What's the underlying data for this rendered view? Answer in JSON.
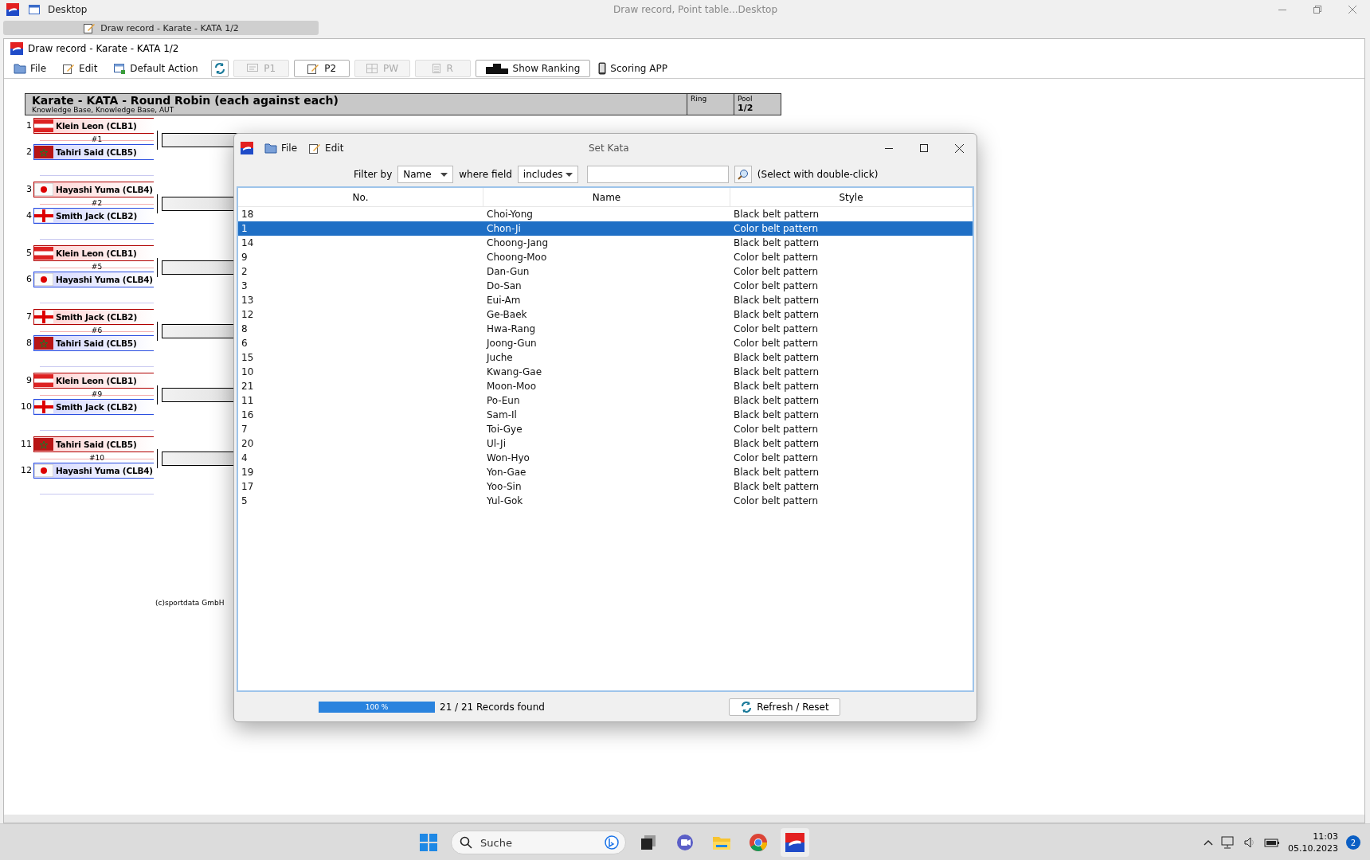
{
  "os_titlebar": {
    "title": "Desktop",
    "center_title": "Draw record, Point table...Desktop"
  },
  "document_tab": {
    "label": "Draw record - Karate - KATA 1/2"
  },
  "window": {
    "title": "Draw record - Karate - KATA 1/2",
    "toolbar": [
      {
        "kind": "menu",
        "label": "File",
        "disabled": false
      },
      {
        "kind": "menu",
        "label": "Edit",
        "disabled": false
      },
      {
        "kind": "menu",
        "label": "Default Action",
        "disabled": false
      },
      {
        "kind": "iconbutton",
        "disabled": false
      },
      {
        "kind": "button",
        "label": "P1",
        "disabled": true
      },
      {
        "kind": "button",
        "label": "P2",
        "disabled": false
      },
      {
        "kind": "button",
        "label": "PW",
        "disabled": true
      },
      {
        "kind": "button",
        "label": "R",
        "disabled": true
      },
      {
        "kind": "button",
        "label": "Show Ranking",
        "disabled": false
      },
      {
        "kind": "menu",
        "label": "Scoring APP",
        "disabled": false
      }
    ]
  },
  "draw": {
    "header": {
      "title": "Karate - KATA - Round Robin (each against each)",
      "subtitle": "Knowledge Base, Knowledge Base, AUT",
      "ring_label": "Ring",
      "pool_label": "Pool",
      "pool_value": "1/2"
    },
    "matches": [
      {
        "number": "#1",
        "competitors": [
          {
            "seed": "1",
            "name": "Klein Leon (CLB1)",
            "kind": "aut"
          },
          {
            "seed": "2",
            "name": "Tahiri Said (CLB5)",
            "kind": "mar"
          }
        ]
      },
      {
        "number": "#2",
        "competitors": [
          {
            "seed": "3",
            "name": "Hayashi Yuma (CLB4)",
            "kind": "jpn"
          },
          {
            "seed": "4",
            "name": "Smith Jack (CLB2)",
            "kind": "eng"
          }
        ]
      },
      {
        "number": "#5",
        "competitors": [
          {
            "seed": "5",
            "name": "Klein Leon (CLB1)",
            "kind": "aut"
          },
          {
            "seed": "6",
            "name": "Hayashi Yuma (CLB4)",
            "kind": "jpn"
          }
        ]
      },
      {
        "number": "#6",
        "competitors": [
          {
            "seed": "7",
            "name": "Smith Jack (CLB2)",
            "kind": "eng"
          },
          {
            "seed": "8",
            "name": "Tahiri Said (CLB5)",
            "kind": "mar"
          }
        ]
      },
      {
        "number": "#9",
        "competitors": [
          {
            "seed": "9",
            "name": "Klein Leon (CLB1)",
            "kind": "aut"
          },
          {
            "seed": "10",
            "name": "Smith Jack (CLB2)",
            "kind": "eng"
          }
        ]
      },
      {
        "number": "#10",
        "competitors": [
          {
            "seed": "11",
            "name": "Tahiri Said (CLB5)",
            "kind": "mar"
          },
          {
            "seed": "12",
            "name": "Hayashi Yuma (CLB4)",
            "kind": "jpn"
          }
        ]
      }
    ],
    "copyright": "(c)sportdata GmbH"
  },
  "dialog": {
    "title": "Set Kata",
    "menu": [
      "File",
      "Edit"
    ],
    "filter": {
      "label": "Filter by",
      "field": "Name",
      "where_label": "where field",
      "operator": "includes",
      "hint": "(Select with double-click)"
    },
    "columns": [
      "No.",
      "Name",
      "Style"
    ],
    "rows": [
      {
        "no": "18",
        "name": "Choi-Yong",
        "style": "Black belt pattern",
        "selected": false
      },
      {
        "no": "1",
        "name": "Chon-Ji",
        "style": "Color belt pattern",
        "selected": true
      },
      {
        "no": "14",
        "name": "Choong-Jang",
        "style": "Black belt pattern",
        "selected": false
      },
      {
        "no": "9",
        "name": "Choong-Moo",
        "style": "Color belt pattern",
        "selected": false
      },
      {
        "no": "2",
        "name": "Dan-Gun",
        "style": "Color belt pattern",
        "selected": false
      },
      {
        "no": "3",
        "name": "Do-San",
        "style": "Color belt pattern",
        "selected": false
      },
      {
        "no": "13",
        "name": "Eui-Am",
        "style": "Black belt pattern",
        "selected": false
      },
      {
        "no": "12",
        "name": "Ge-Baek",
        "style": "Black belt pattern",
        "selected": false
      },
      {
        "no": "8",
        "name": "Hwa-Rang",
        "style": "Color belt pattern",
        "selected": false
      },
      {
        "no": "6",
        "name": "Joong-Gun",
        "style": "Color belt pattern",
        "selected": false
      },
      {
        "no": "15",
        "name": "Juche",
        "style": "Black belt pattern",
        "selected": false
      },
      {
        "no": "10",
        "name": "Kwang-Gae",
        "style": "Black belt pattern",
        "selected": false
      },
      {
        "no": "21",
        "name": "Moon-Moo",
        "style": "Black belt pattern",
        "selected": false
      },
      {
        "no": "11",
        "name": "Po-Eun",
        "style": "Black belt pattern",
        "selected": false
      },
      {
        "no": "16",
        "name": "Sam-Il",
        "style": "Black belt pattern",
        "selected": false
      },
      {
        "no": "7",
        "name": "Toi-Gye",
        "style": "Color belt pattern",
        "selected": false
      },
      {
        "no": "20",
        "name": "Ul-Ji",
        "style": "Black belt pattern",
        "selected": false
      },
      {
        "no": "4",
        "name": "Won-Hyo",
        "style": "Color belt pattern",
        "selected": false
      },
      {
        "no": "19",
        "name": "Yon-Gae",
        "style": "Black belt pattern",
        "selected": false
      },
      {
        "no": "17",
        "name": "Yoo-Sin",
        "style": "Black belt pattern",
        "selected": false
      },
      {
        "no": "5",
        "name": "Yul-Gok",
        "style": "Color belt pattern",
        "selected": false
      }
    ],
    "progress": {
      "level": 1,
      "text": "100 %"
    },
    "records": "21 / 21 Records found",
    "refresh_button": "Refresh / Reset"
  },
  "taskbar": {
    "search_placeholder": "Suche",
    "time": "11:03",
    "date": "05.10.2023",
    "notification_count": "2"
  }
}
